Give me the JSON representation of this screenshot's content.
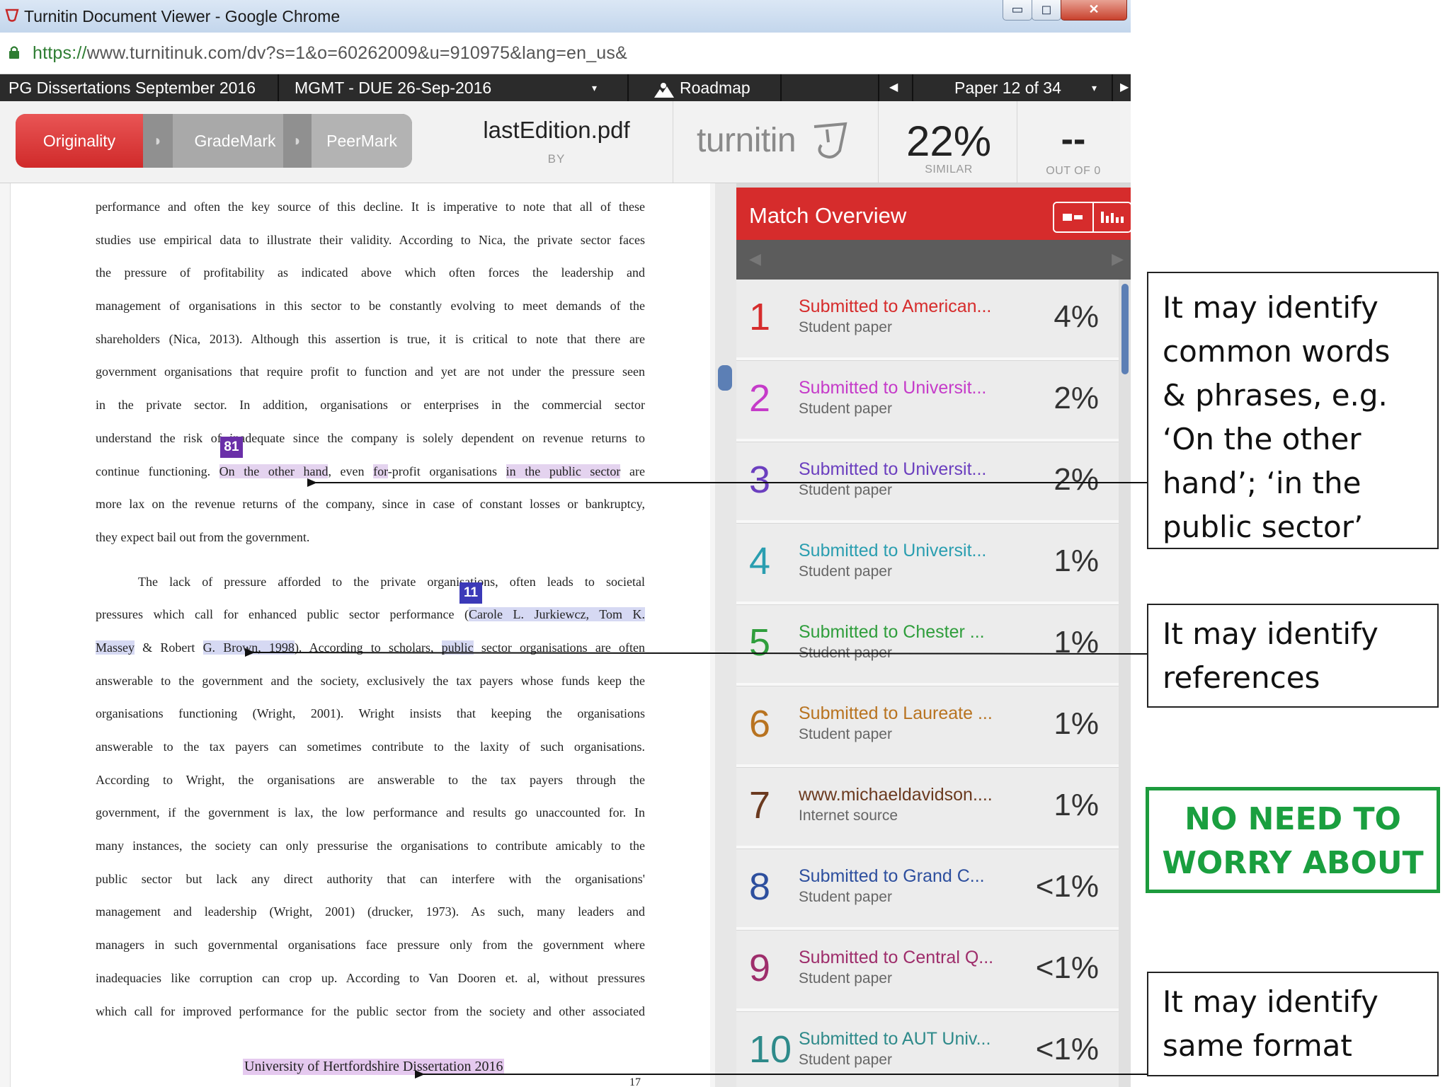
{
  "window": {
    "title": "Turnitin Document Viewer - Google Chrome",
    "min_glyph": "▭",
    "max_glyph": "◻",
    "close_glyph": "✕"
  },
  "address": {
    "url_secure": "https://",
    "url_rest": "www.turnitinuk.com/dv?s=1&o=60262009&u=910975&lang=en_us&"
  },
  "nav": {
    "class_name": "PG Dissertations September 2016",
    "assignment": "MGMT - DUE 26-Sep-2016",
    "dropdown_arrow": "▾",
    "roadmap": "Roadmap",
    "prev_arrow": "◀",
    "paper": "Paper 12 of 34",
    "next_arrow": "▶"
  },
  "toolbar": {
    "tabs": [
      "Originality",
      "GradeMark",
      "PeerMark"
    ],
    "file_name": "lastEdition.pdf",
    "by_label": "BY",
    "brand": "turnitin",
    "similarity": "22%",
    "similarity_label": "SIMILAR",
    "grade": "--",
    "grade_label": "OUT OF 0"
  },
  "document": {
    "lines": [
      "performance and often the key source of this decline. It is imperative to note that all of these",
      "studies use empirical data to illustrate their validity. According to Nica, the private sector faces",
      "the pressure of profitability as indicated above which often forces the leadership and",
      "management of organisations in this sector to be constantly evolving to meet demands of the",
      "shareholders (Nica, 2013). Although this assertion is true, it is critical to note that there are",
      "government organisations that require profit to function and yet are not under the pressure seen",
      "in the private sector. In addition, organisations or enterprises in the commercial sector",
      "understand the risk of inadequate since the company is solely dependent on revenue returns to"
    ],
    "line9": {
      "a": "continue functioning. ",
      "b": "On the other hand",
      "c": ", even ",
      "d": "for",
      "e": "-profit organisations ",
      "f": "in the public sector",
      "g": " are"
    },
    "lines2": [
      "more lax on the revenue returns of the company, since in case of constant losses or bankruptcy,",
      "they expect bail out from the government."
    ],
    "para2_first": "The lack of pressure afforded to the private organisations, often leads to societal",
    "line_ref1": {
      "a": "pressures which call for enhanced public sector performance (",
      "b": "Carole L. Jurkiewcz, ",
      "c": "Tom K."
    },
    "line_ref2": {
      "a": "Massey",
      "b": " & Robert ",
      "c": "G. Brown, 1998",
      "d": "). According to scholars, ",
      "e": "public",
      "f": " sector organisations are often"
    },
    "lines3": [
      "answerable to the government and the society, exclusively the tax payers whose funds keep the",
      "organisations functioning (Wright, 2001). Wright insists that keeping the organisations",
      "answerable to the tax payers can sometimes contribute to the laxity of such organisations.",
      "According to Wright, the organisations are answerable to the tax payers through the",
      "government, if the government is lax, the low performance and results go unaccounted for. In",
      "many instances, the society can only pressurise the organisations to contribute amicably to the",
      "public sector but lack any direct authority that can interfere with the organisations'",
      "management and leadership (Wright, 2001) (drucker, 1973). As such, many leaders and",
      "managers in such governmental organisations face pressure only from the government where",
      "inadequacies like corruption can crop up. According to Van Dooren et. al, without pressures",
      "which call for improved performance for the public sector from the society and other associated"
    ],
    "flag_81": "81",
    "flag_11": "11",
    "footer": "University of Hertfordshire Dissertation 2016",
    "page_number": "17"
  },
  "panel": {
    "title": "Match Overview",
    "prev": "◀",
    "next": "▶",
    "matches": [
      {
        "num": "1",
        "source": "Submitted to American...",
        "type": "Student paper",
        "pct": "4%",
        "color": "#d62c2c"
      },
      {
        "num": "2",
        "source": "Submitted to Universit...",
        "type": "Student paper",
        "pct": "2%",
        "color": "#c53bc9"
      },
      {
        "num": "3",
        "source": "Submitted to Universit...",
        "type": "Student paper",
        "pct": "2%",
        "color": "#6b3fbf"
      },
      {
        "num": "4",
        "source": "Submitted to Universit...",
        "type": "Student paper",
        "pct": "1%",
        "color": "#2a9eb0"
      },
      {
        "num": "5",
        "source": "Submitted to Chester ...",
        "type": "Student paper",
        "pct": "1%",
        "color": "#2f9e3c"
      },
      {
        "num": "6",
        "source": "Submitted to Laureate ...",
        "type": "Student paper",
        "pct": "1%",
        "color": "#b87320"
      },
      {
        "num": "7",
        "source": "www.michaeldavidson....",
        "type": "Internet source",
        "pct": "1%",
        "color": "#6b3a1f"
      },
      {
        "num": "8",
        "source": "Submitted to Grand C...",
        "type": "Student paper",
        "pct": "<1%",
        "color": "#2d4f9e"
      },
      {
        "num": "9",
        "source": "Submitted to Central Q...",
        "type": "Student paper",
        "pct": "<1%",
        "color": "#9e2d6b"
      },
      {
        "num": "10",
        "source": "Submitted to AUT Univ...",
        "type": "Student paper",
        "pct": "<1%",
        "color": "#2e8a8a"
      }
    ]
  },
  "annotations": {
    "common_words": [
      "It may identify",
      "common words",
      "& phrases, e.g.",
      "‘On the other",
      "hand’; ‘in the",
      "public sector’"
    ],
    "references": [
      "It may identify",
      "references"
    ],
    "no_worry": [
      "NO NEED TO",
      "WORRY ABOUT"
    ],
    "same_format": [
      "It may identify",
      "same format"
    ]
  }
}
